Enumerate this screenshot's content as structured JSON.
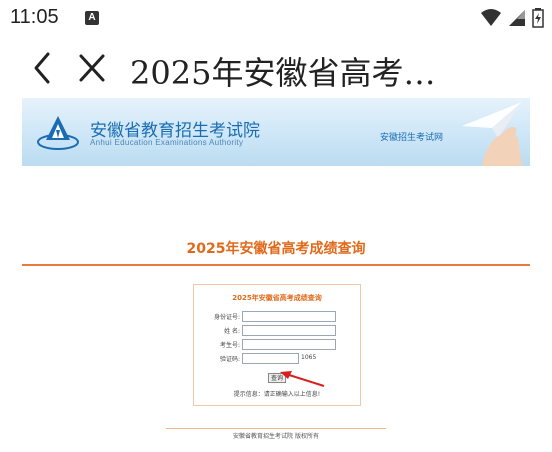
{
  "status_bar": {
    "time": "11:05",
    "notification_icon": "A"
  },
  "toolbar": {
    "title": "2025年安徽省高考…"
  },
  "banner": {
    "org_name": "安徽省教育招生考试院",
    "org_name_en": "Anhui Education Examinations Authority",
    "site_name": "安徽招生考试网"
  },
  "page": {
    "heading": "2025年安徽省高考成绩查询"
  },
  "form": {
    "title": "2025年安徽省高考成绩查询",
    "fields": [
      {
        "label": "身份证号:",
        "value": ""
      },
      {
        "label": "姓 名:",
        "value": ""
      },
      {
        "label": "考生号:",
        "value": ""
      },
      {
        "label": "验证码:",
        "value": ""
      }
    ],
    "verify_code": "1065",
    "submit_label": "查询",
    "hint": "提示信息：请正确输入以上信息!"
  },
  "footer": {
    "copyright": "安徽省教育招生考试院 版权所有"
  },
  "colors": {
    "accent": "#e06a1b",
    "brand_blue": "#1a6db3"
  }
}
